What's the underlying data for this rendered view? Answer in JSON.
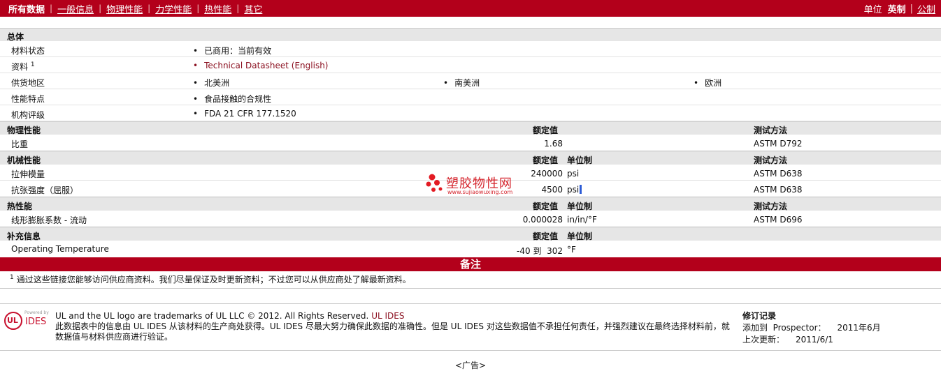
{
  "nav": {
    "all": "所有数据",
    "general": "一般信息",
    "physical": "物理性能",
    "mechanical": "力学性能",
    "thermal": "热性能",
    "other": "其它"
  },
  "units": {
    "label": "单位",
    "english": "英制",
    "metric": "公制"
  },
  "general": {
    "title": "总体",
    "rows": [
      {
        "label": "材料状态",
        "values": [
          "已商用：当前有效"
        ]
      },
      {
        "label": "资料",
        "sup": "1",
        "values": [
          "Technical Datasheet (English)"
        ]
      },
      {
        "label": "供货地区",
        "values": [
          "北美洲",
          "南美洲",
          "欧洲"
        ]
      },
      {
        "label": "性能特点",
        "values": [
          "食品接触的合规性"
        ]
      },
      {
        "label": "机构评级",
        "values": [
          "FDA 21 CFR 177.1520"
        ]
      }
    ]
  },
  "headers": {
    "nominal": "额定值",
    "unit": "单位制",
    "method": "测试方法"
  },
  "physical": {
    "title": "物理性能",
    "rows": [
      {
        "label": "比重",
        "value": "1.68",
        "unit": "",
        "method": "ASTM D792"
      }
    ]
  },
  "mechanical": {
    "title": "机械性能",
    "rows": [
      {
        "label": "拉伸模量",
        "value": "240000",
        "unit": "psi",
        "method": "ASTM D638"
      },
      {
        "label": "抗张强度（屈服）",
        "value": "4500",
        "unit": "psi",
        "method": "ASTM D638"
      }
    ]
  },
  "thermal": {
    "title": "热性能",
    "rows": [
      {
        "label": "线形膨胀系数  - 流动",
        "value": "0.000028",
        "unit": "in/in/°F",
        "method": "ASTM D696"
      }
    ]
  },
  "supplemental": {
    "title": "补充信息",
    "rows": [
      {
        "label": "Operating Temperature",
        "value": "-40 到  302",
        "unit": "°F",
        "method": ""
      }
    ]
  },
  "watermark": {
    "text": "塑胶物性网",
    "url": "www.sujiaowuxing.com"
  },
  "notes": {
    "title": "备注",
    "sup": "1",
    "footnote": "通过这些链接您能够访问供应商资料。我们尽量保证及时更新资料；不过您可以从供应商处了解最新资料。"
  },
  "footer": {
    "logo_powered": "Powered by",
    "logo_ul": "UL",
    "logo_ides": "IDES",
    "trademark": "UL and the UL logo are trademarks of UL LLC © 2012. All Rights Reserved.",
    "trademark_link": "UL IDES",
    "disclaimer": "此数据表中的信息由  UL IDES 从该材料的生产商处获得。UL IDES 尽最大努力确保此数据的准确性。但是  UL IDES 对这些数据值不承担任何责任，并强烈建议在最终选择材料前，就数据值与材料供应商进行验证。",
    "revision_title": "修订记录",
    "added_label": "添加到  Prospector：",
    "added_value": "2011年6月",
    "updated_label": "上次更新：",
    "updated_value": "2011/6/1",
    "ad": "<广告>"
  },
  "colors": {
    "brand": "#b3001b",
    "section_bg": "#e6e6e6",
    "link": "#8b1020"
  }
}
